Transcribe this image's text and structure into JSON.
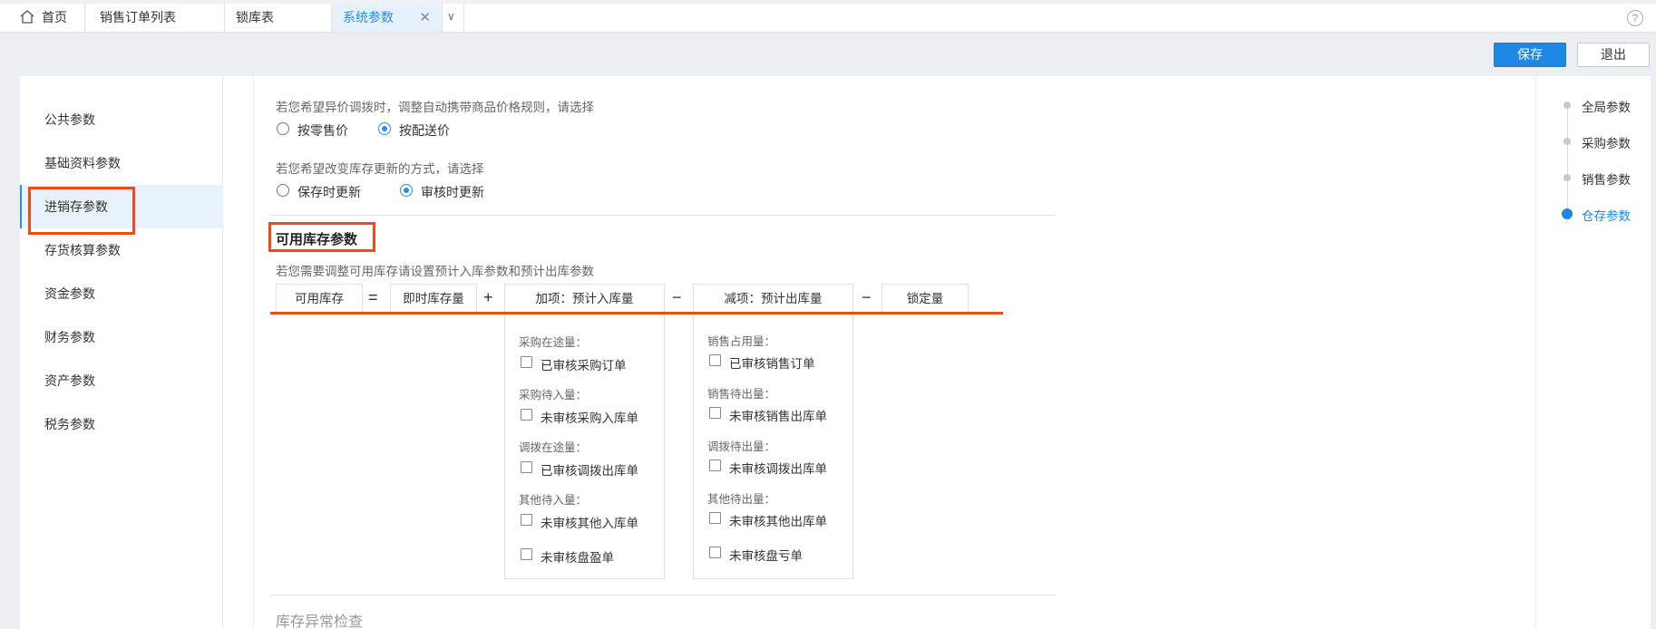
{
  "tabs": {
    "home": "首页",
    "sales_orders": "销售订单列表",
    "lock_table": "锁库表",
    "system_params": "系统参数",
    "close_glyph": "✕",
    "more_glyph": "∨",
    "help_glyph": "?"
  },
  "toolbar": {
    "save_label": "保存",
    "exit_label": "退出"
  },
  "leftnav": {
    "items": [
      "公共参数",
      "基础资料参数",
      "进销存参数",
      "存货核算参数",
      "资金参数",
      "财务参数",
      "资产参数",
      "税务参数"
    ],
    "active_index": 2
  },
  "settings": {
    "price_rule_hint": "若您希望异价调拨时，调整自动携带商品价格规则，请选择",
    "price_rule_options": [
      "按零售价",
      "按配送价"
    ],
    "price_rule_selected": 1,
    "stock_update_hint": "若您希望改变库存更新的方式，请选择",
    "stock_update_options": [
      "保存时更新",
      "审核时更新"
    ],
    "stock_update_selected": 1
  },
  "available_stock": {
    "title": "可用库存参数",
    "hint": "若您需要调整可用库存请设置预计入库参数和预计出库参数",
    "formula": {
      "available": "可用库存",
      "eq": "=",
      "instant": "即时库存量",
      "plus": "+",
      "add_expected_in": "加项：预计入库量",
      "minus": "−",
      "sub_expected_out": "减项：预计出库量",
      "minus2": "−",
      "locked": "锁定量"
    },
    "inbound_groups": [
      {
        "label": "采购在途量：",
        "option": "已审核采购订单"
      },
      {
        "label": "采购待入量：",
        "option": "未审核采购入库单"
      },
      {
        "label": "调拨在途量：",
        "option": "已审核调拨出库单"
      },
      {
        "label": "其他待入量：",
        "option": "未审核其他入库单"
      },
      {
        "label": "",
        "option": "未审核盘盈单"
      }
    ],
    "outbound_groups": [
      {
        "label": "销售占用量：",
        "option": "已审核销售订单"
      },
      {
        "label": "销售待出量：",
        "option": "未审核销售出库单"
      },
      {
        "label": "调拨待出量：",
        "option": "未审核调拨出库单"
      },
      {
        "label": "其他待出量：",
        "option": "未审核其他出库单"
      },
      {
        "label": "",
        "option": "未审核盘亏单"
      }
    ]
  },
  "next_section": "库存异常检查",
  "anchors": {
    "items": [
      "全局参数",
      "采购参数",
      "销售参数",
      "仓存参数"
    ],
    "active_index": 3
  },
  "colors": {
    "accent": "#1e88e5",
    "highlight": "#f04a1a"
  }
}
